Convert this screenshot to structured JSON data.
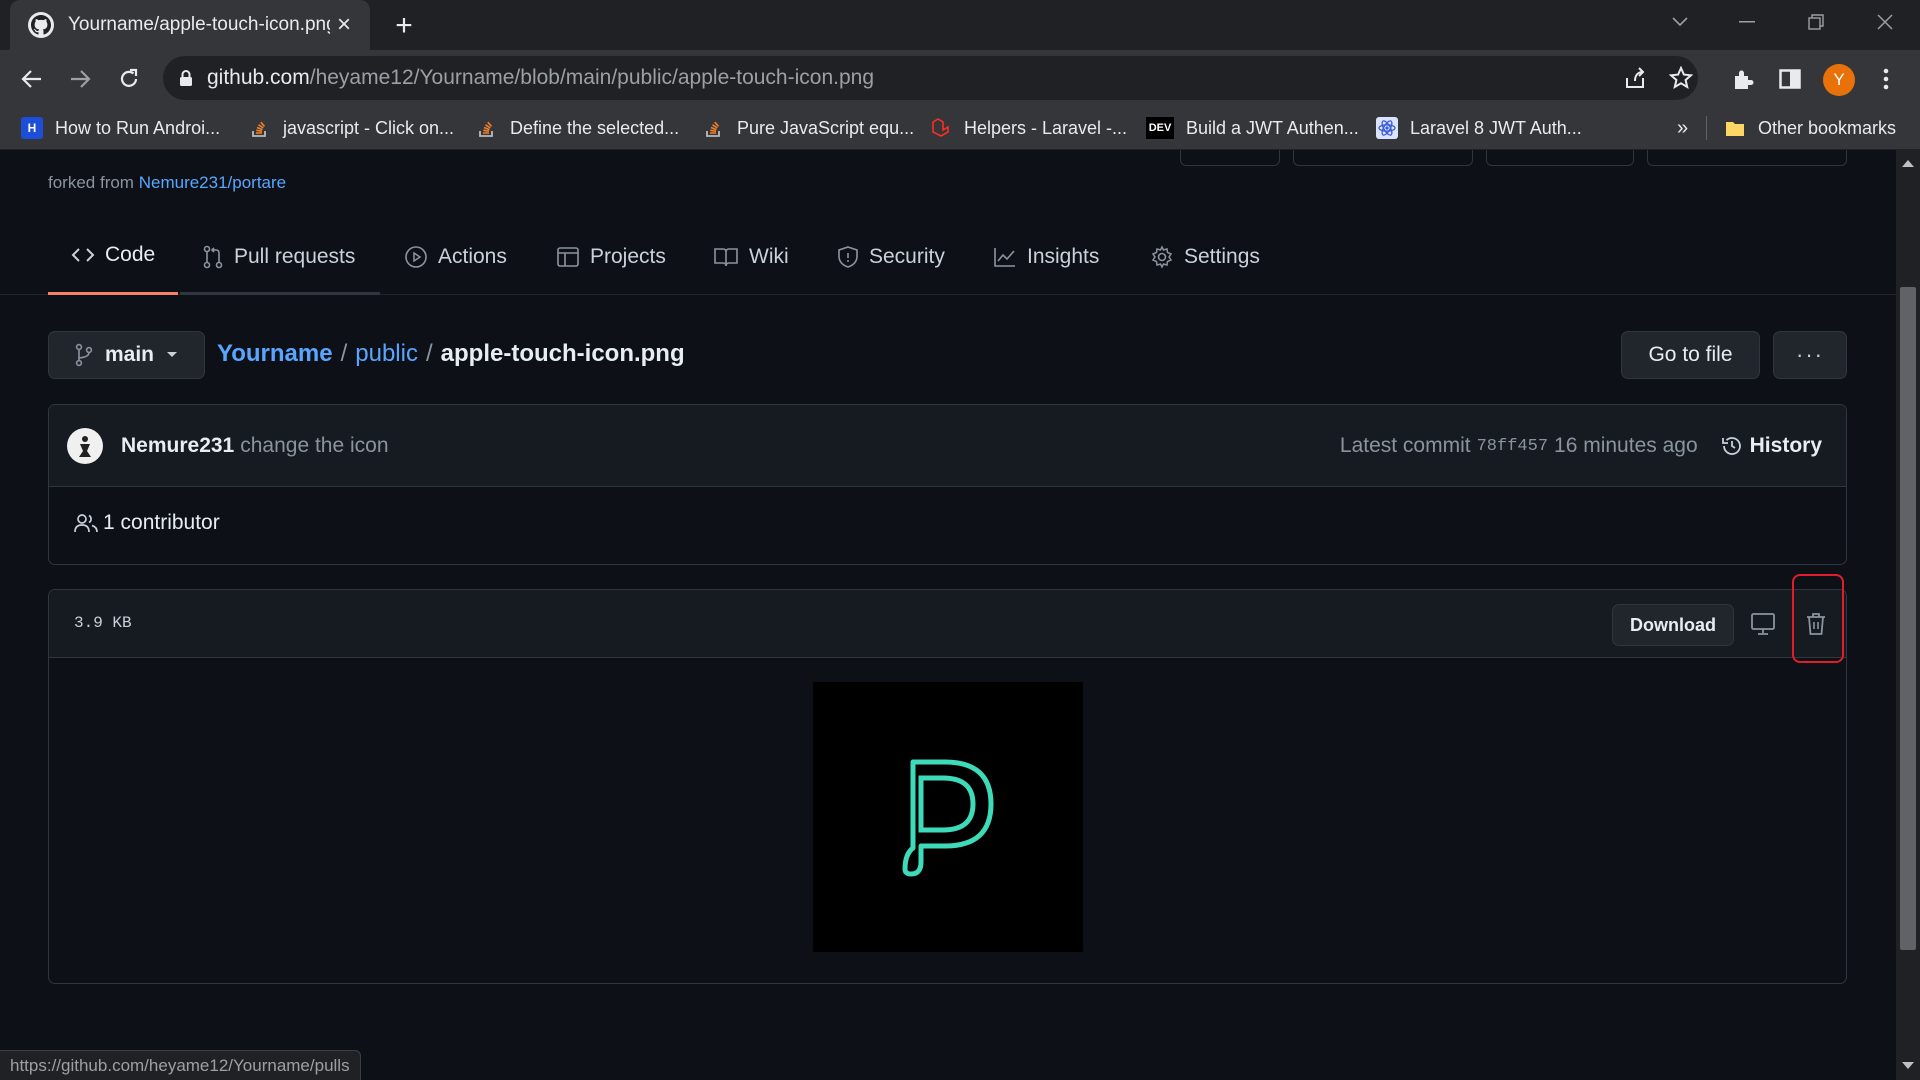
{
  "browser": {
    "tab_title": "Yourname/apple-touch-icon.png",
    "url_host": "github.com",
    "url_path": "/heyame12/Yourname/blob/main/public/apple-touch-icon.png",
    "profile_initial": "Y",
    "bookmarks": [
      {
        "label": "How to Run Androi...",
        "icon": "H"
      },
      {
        "label": "javascript - Click on...",
        "icon": ""
      },
      {
        "label": "Define the selected...",
        "icon": ""
      },
      {
        "label": "Pure JavaScript equ...",
        "icon": ""
      },
      {
        "label": "Helpers - Laravel -...",
        "icon": ""
      },
      {
        "label": "Build a JWT Authen...",
        "icon": "DEV"
      },
      {
        "label": "Laravel 8 JWT Auth...",
        "icon": ""
      }
    ],
    "bookmarks_overflow": "»",
    "other_bookmarks": "Other bookmarks",
    "status_url": "https://github.com/heyame12/Yourname/pulls"
  },
  "repo": {
    "forked_prefix": "forked from",
    "forked_from": "Nemure231/portare",
    "nav": [
      "Code",
      "Pull requests",
      "Actions",
      "Projects",
      "Wiki",
      "Security",
      "Insights",
      "Settings"
    ],
    "branch": "main",
    "breadcrumb": {
      "repo": "Yourname",
      "sep1": "/",
      "folder": "public",
      "sep2": "/",
      "file": "apple-touch-icon.png"
    },
    "go_to_file": "Go to file",
    "more": "···"
  },
  "commit": {
    "author": "Nemure231",
    "message": "change the icon",
    "latest_label": "Latest commit",
    "sha": "78ff457",
    "time": "16 minutes ago",
    "history": "History",
    "contributors": "1 contributor"
  },
  "file": {
    "size": "3.9 KB",
    "download": "Download",
    "accent": "#3ddbb9"
  }
}
